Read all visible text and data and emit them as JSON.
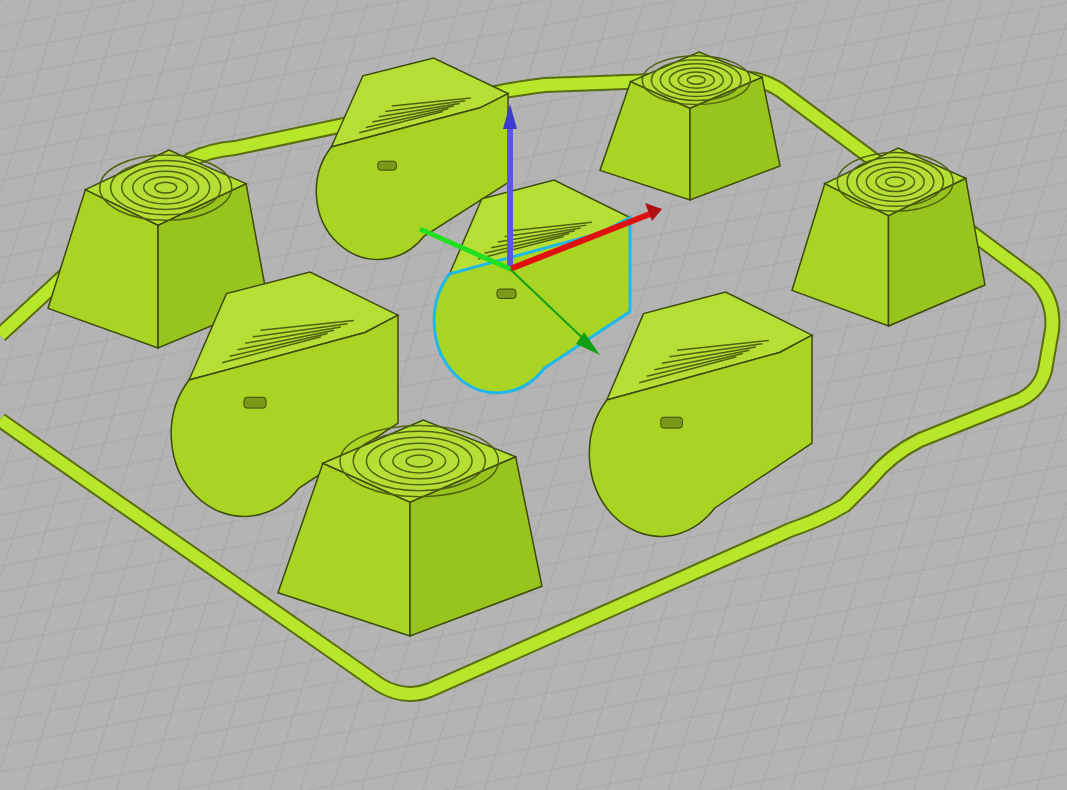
{
  "viewport": {
    "objects": [
      {
        "kind": "clip",
        "selected": false
      },
      {
        "kind": "frustum",
        "selected": false
      },
      {
        "kind": "frustum",
        "selected": false
      },
      {
        "kind": "clip",
        "selected": true
      },
      {
        "kind": "frustum",
        "selected": false
      },
      {
        "kind": "clip",
        "selected": false
      },
      {
        "kind": "clip",
        "selected": false
      },
      {
        "kind": "frustum",
        "selected": false
      }
    ]
  }
}
